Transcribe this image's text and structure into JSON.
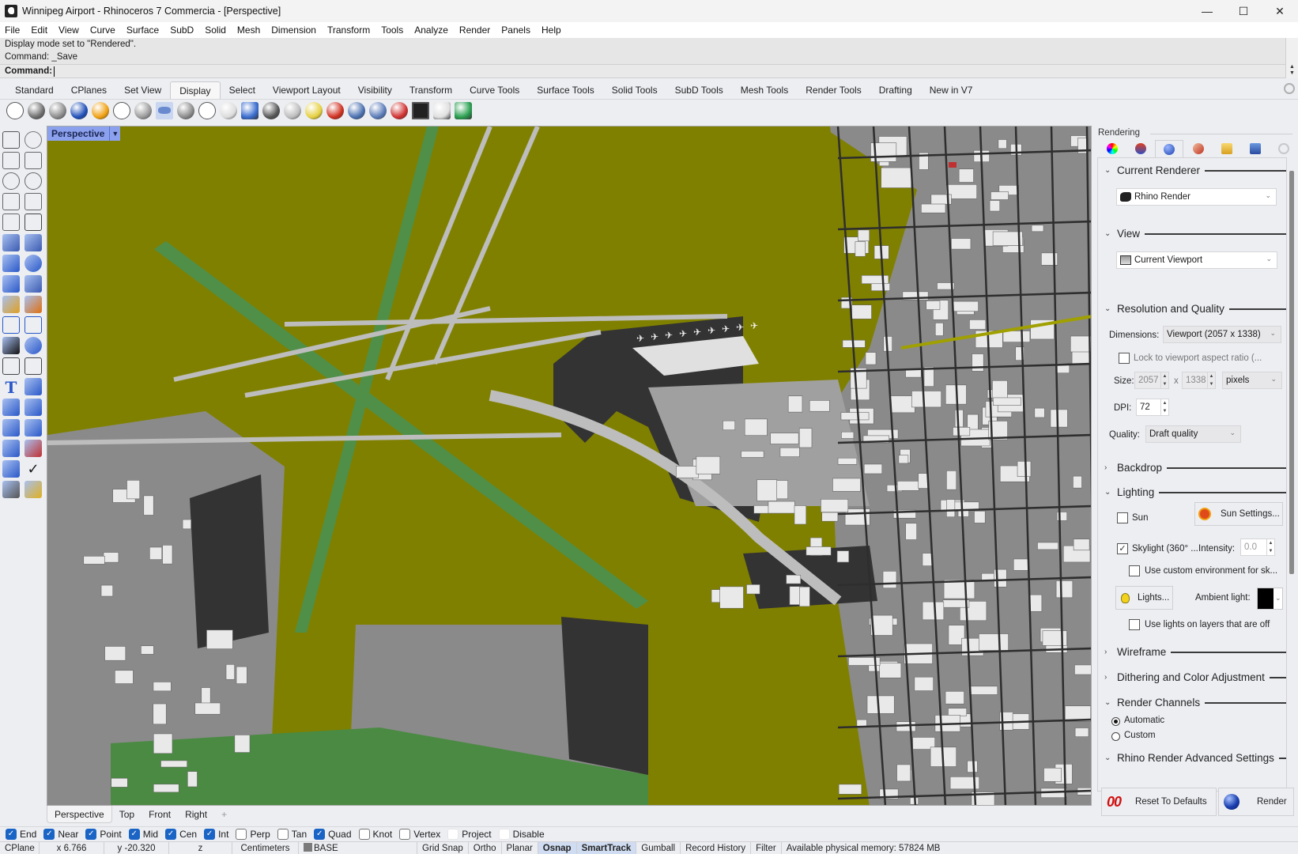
{
  "window": {
    "title": "Winnipeg Airport - Rhinoceros 7 Commercia - [Perspective]",
    "controls": {
      "minimize": "—",
      "maximize": "☐",
      "close": "✕"
    }
  },
  "menu": [
    "File",
    "Edit",
    "View",
    "Curve",
    "Surface",
    "SubD",
    "Solid",
    "Mesh",
    "Dimension",
    "Transform",
    "Tools",
    "Analyze",
    "Render",
    "Panels",
    "Help"
  ],
  "command": {
    "history": [
      "Display mode set to \"Rendered\".",
      "Command: _Save"
    ],
    "prompt_label": "Command:",
    "value": ""
  },
  "toolbar_tabs": {
    "active": "Display",
    "items": [
      "Standard",
      "CPlanes",
      "Set View",
      "Display",
      "Select",
      "Viewport Layout",
      "Visibility",
      "Transform",
      "Curve Tools",
      "Surface Tools",
      "Solid Tools",
      "SubD Tools",
      "Mesh Tools",
      "Render Tools",
      "Drafting",
      "New in V7"
    ]
  },
  "display_icons": [
    {
      "name": "wireframe-icon",
      "color": "#ffffff"
    },
    {
      "name": "shaded-icon",
      "color": "#6d6d6d"
    },
    {
      "name": "rendered-icon",
      "color": "#8a8a8a"
    },
    {
      "name": "rendered-blue-icon",
      "color": "#1f4fb8"
    },
    {
      "name": "arctic-icon",
      "color": "#f0a010"
    },
    {
      "name": "ghosted-icon",
      "color": "#ffffff"
    },
    {
      "name": "xray-icon",
      "color": "#9a9a9a"
    },
    {
      "name": "technical-icon",
      "color": "#6a8ad0"
    },
    {
      "name": "artistic-icon",
      "color": "#8a8a8a"
    },
    {
      "name": "pen-icon",
      "color": "#ffffff"
    },
    {
      "name": "monochrome-icon",
      "color": "#dcdcdc"
    },
    {
      "name": "display-options-icon",
      "color": "#3a6ed0"
    },
    {
      "name": "mesh-sphere-icon",
      "color": "#555555"
    },
    {
      "name": "flat-shade-icon",
      "color": "#bdbdbd"
    },
    {
      "name": "lightbulb-sphere-icon",
      "color": "#e6d040"
    },
    {
      "name": "cplane-axes-icon",
      "color": "#d03020"
    },
    {
      "name": "camera-icon",
      "color": "#4a70b0"
    },
    {
      "name": "capture-icon",
      "color": "#5a7ab8"
    },
    {
      "name": "hide-icon",
      "color": "#d03030"
    },
    {
      "name": "monitor-icon",
      "color": "#222222"
    },
    {
      "name": "boxes-icon",
      "color": "#e0e0e0"
    },
    {
      "name": "color-boxes-icon",
      "color": "#2aa050"
    }
  ],
  "left_tools": [
    "select-arrow-icon",
    "point-icon",
    "polyline-icon",
    "curve-icon",
    "circle-icon",
    "ellipse-icon",
    "arc-icon",
    "rectangle-icon",
    "polygon-icon",
    "fillet-icon",
    "surface-icon",
    "extrude-surface-icon",
    "box-icon",
    "spheres-icon",
    "cylinder-icon",
    "mesh-icon",
    "puzzle-icon",
    "explode-icon",
    "trim-icon",
    "split-icon",
    "boolean-icon",
    "points-icon",
    "curve-from-object-icon",
    "offset-curve-icon",
    "text-icon",
    "scale-icon",
    "transform-icon",
    "move-icon",
    "solid-tools-icon",
    "grid-array-icon",
    "array-icon",
    "align-icon",
    "analyze-icon",
    "check-icon",
    "render-icon",
    "material-icon"
  ],
  "viewport": {
    "label": "Perspective",
    "tabs": [
      "Perspective",
      "Top",
      "Front",
      "Right"
    ],
    "add_tab": "+",
    "colors": {
      "grass": "#808000",
      "runway": "#4f8f48",
      "apron": "#333333",
      "pavement": "#bdbdbd",
      "ground": "#8a8a8a",
      "building": "#e9e9e9",
      "field": "#4a8a42"
    }
  },
  "osnaps": [
    {
      "label": "End",
      "checked": true
    },
    {
      "label": "Near",
      "checked": true
    },
    {
      "label": "Point",
      "checked": true
    },
    {
      "label": "Mid",
      "checked": true
    },
    {
      "label": "Cen",
      "checked": true
    },
    {
      "label": "Int",
      "checked": true
    },
    {
      "label": "Perp",
      "checked": false
    },
    {
      "label": "Tan",
      "checked": false
    },
    {
      "label": "Quad",
      "checked": true
    },
    {
      "label": "Knot",
      "checked": false
    },
    {
      "label": "Vertex",
      "checked": false
    },
    {
      "label": "Project",
      "checked": false,
      "faint": true
    },
    {
      "label": "Disable",
      "checked": false,
      "faint": true
    }
  ],
  "status": {
    "cplane": "CPlane",
    "x": "x 6.766",
    "y": "y -20.320",
    "z": "z",
    "units": "Centimeters",
    "layer": "BASE",
    "toggles": [
      {
        "label": "Grid Snap",
        "active": false
      },
      {
        "label": "Ortho",
        "active": false
      },
      {
        "label": "Planar",
        "active": false
      },
      {
        "label": "Osnap",
        "active": true
      },
      {
        "label": "SmartTrack",
        "active": true
      },
      {
        "label": "Gumball",
        "active": false
      },
      {
        "label": "Record History",
        "active": false
      },
      {
        "label": "Filter",
        "active": false
      }
    ],
    "memory": "Available physical memory: 57824 MB"
  },
  "panel": {
    "title": "Rendering",
    "tabs": [
      "color-wheel-icon",
      "material-icon",
      "environment-icon",
      "texture-icon",
      "folder-icon",
      "help-icon",
      "gear-icon"
    ],
    "active_tab": 2,
    "sections": {
      "current_renderer": {
        "title": "Current Renderer",
        "value": "Rhino Render"
      },
      "view": {
        "title": "View",
        "value": "Current Viewport"
      },
      "resolution": {
        "title": "Resolution and Quality",
        "dimensions_label": "Dimensions:",
        "dimensions_value": "Viewport (2057 x 1338)",
        "lock_label": "Lock to viewport aspect ratio (...",
        "lock_checked": false,
        "size_label": "Size:",
        "width": "2057",
        "x_label": "x",
        "height": "1338",
        "units": "pixels",
        "dpi_label": "DPI:",
        "dpi": "72",
        "quality_label": "Quality:",
        "quality": "Draft quality"
      },
      "backdrop": {
        "title": "Backdrop"
      },
      "lighting": {
        "title": "Lighting",
        "sun_label": "Sun",
        "sun_checked": false,
        "sun_settings": "Sun Settings...",
        "skylight_label": "Skylight (360° ...",
        "skylight_checked": true,
        "intensity_label": "Intensity:",
        "intensity": "0.0",
        "custom_env_label": "Use custom environment for sk...",
        "custom_env_checked": false,
        "lights_button": "Lights...",
        "ambient_label": "Ambient light:",
        "ambient_color": "#000000",
        "layers_off_label": "Use lights on layers that are off",
        "layers_off_checked": false
      },
      "wireframe": {
        "title": "Wireframe"
      },
      "dithering": {
        "title": "Dithering and Color Adjustment"
      },
      "channels": {
        "title": "Render Channels",
        "options": [
          "Automatic",
          "Custom"
        ],
        "selected": "Automatic"
      },
      "advanced": {
        "title": "Rhino Render Advanced Settings"
      }
    },
    "reset_button": "Reset To Defaults",
    "render_button": "Render"
  }
}
